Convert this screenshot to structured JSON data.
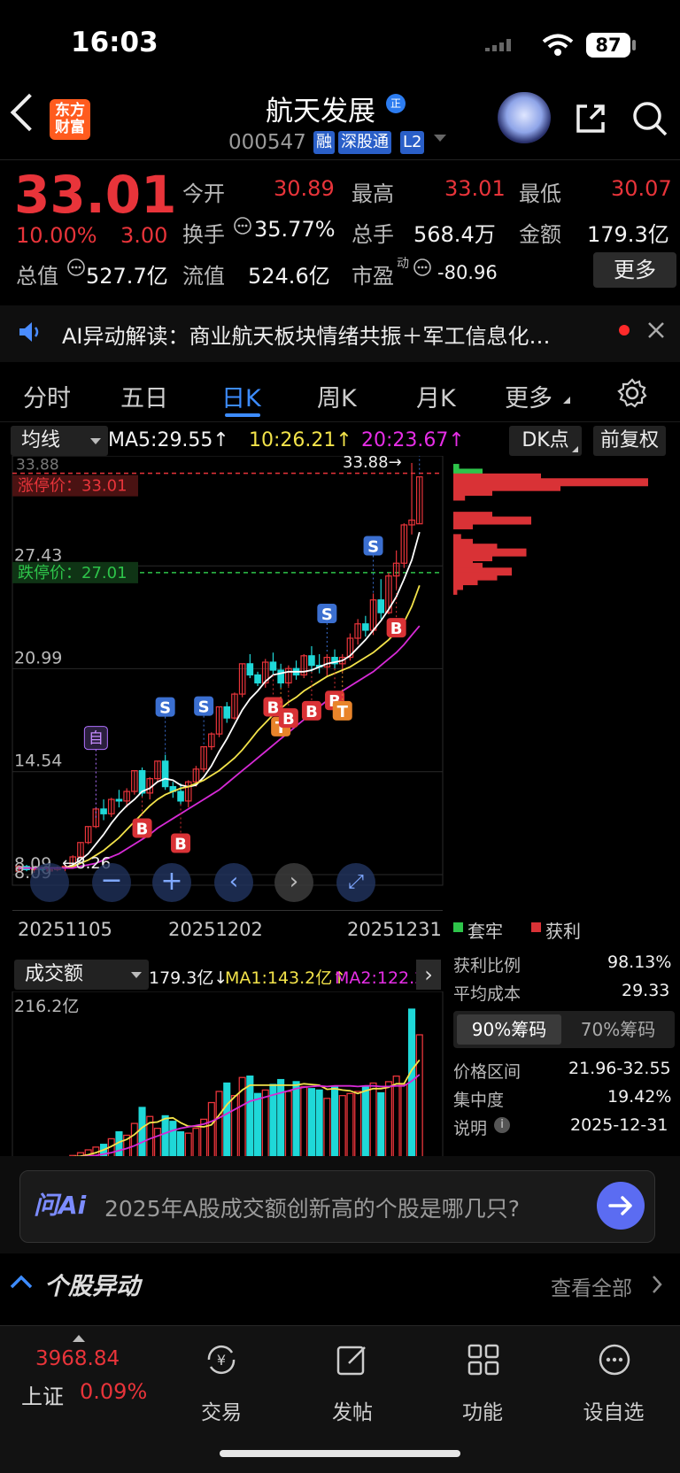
{
  "status_bar": {
    "time": "16:03",
    "battery": "87"
  },
  "header": {
    "logo_line1": "东方",
    "logo_line2": "财富",
    "stock_name": "航天发展",
    "badge": "正",
    "code": "000547",
    "tags": [
      "融",
      "深股通",
      "L2"
    ]
  },
  "quote": {
    "price": "33.01",
    "change_pct": "10.00%",
    "change_amt": "3.00",
    "open_label": "今开",
    "open": "30.89",
    "high_label": "最高",
    "high": "33.01",
    "low_label": "最低",
    "low": "30.07",
    "turnover_label": "换手",
    "turnover": "35.77%",
    "volume_label": "总手",
    "volume": "568.4万",
    "amount_label": "金额",
    "amount": "179.3亿",
    "mcap_label": "总值",
    "mcap": "527.7亿",
    "float_label": "流值",
    "float_cap": "524.6亿",
    "pe_label": "市盈",
    "pe_sup": "动",
    "pe": "-80.96",
    "more": "更多"
  },
  "ai_banner": {
    "text": "AI异动解读：商业航天板块情绪共振＋军工信息化…"
  },
  "tabs": [
    "分时",
    "五日",
    "日K",
    "周K",
    "月K",
    "更多"
  ],
  "active_tab": "日K",
  "chart_toolbar": {
    "indicator": "均线",
    "ma5": "MA5:29.55↑",
    "ma10": "10:26.21↑",
    "ma20": "20:23.67↑",
    "dk": "DK点",
    "adjust": "前复权"
  },
  "price_chart": {
    "limit_up": "涨停价：33.01",
    "limit_down": "跌停价：27.01",
    "top_label": "33.88",
    "high_marker": "33.88",
    "low_marker": "8.26",
    "self_select_marker": "自"
  },
  "chart_data": [
    {
      "type": "candlestick",
      "y_ticks": [
        "27.43",
        "20.99",
        "14.54",
        "8.09"
      ],
      "x_labels": [
        "20251105",
        "20251202",
        "20251231"
      ],
      "ylim": [
        8.09,
        33.88
      ],
      "candles": [
        [
          8.3,
          8.7,
          8.2,
          8.6
        ],
        [
          8.6,
          8.7,
          8.3,
          8.4
        ],
        [
          8.4,
          8.6,
          8.2,
          8.5
        ],
        [
          8.5,
          8.6,
          8.3,
          8.4
        ],
        [
          8.4,
          8.5,
          8.26,
          8.4
        ],
        [
          8.4,
          8.6,
          8.3,
          8.5
        ],
        [
          8.5,
          8.7,
          8.3,
          8.6
        ],
        [
          8.6,
          9.3,
          8.5,
          9.2
        ],
        [
          9.2,
          10.1,
          9.1,
          10.1
        ],
        [
          10.1,
          11.1,
          10.0,
          11.1
        ],
        [
          11.1,
          12.2,
          11.0,
          12.2
        ],
        [
          12.2,
          12.8,
          11.5,
          11.9
        ],
        [
          11.9,
          12.9,
          11.7,
          12.8
        ],
        [
          12.8,
          13.4,
          12.3,
          12.7
        ],
        [
          12.7,
          13.5,
          12.3,
          13.3
        ],
        [
          13.3,
          14.6,
          13.1,
          14.6
        ],
        [
          14.6,
          14.8,
          13.0,
          13.2
        ],
        [
          13.2,
          14.2,
          12.8,
          14.1
        ],
        [
          14.1,
          15.2,
          13.9,
          15.2
        ],
        [
          15.2,
          15.6,
          13.4,
          13.6
        ],
        [
          13.6,
          13.9,
          12.9,
          13.3
        ],
        [
          13.3,
          13.8,
          12.5,
          12.7
        ],
        [
          12.7,
          14.0,
          12.3,
          13.9
        ],
        [
          13.9,
          14.9,
          13.6,
          14.7
        ],
        [
          14.7,
          16.1,
          14.5,
          16.1
        ],
        [
          16.1,
          17.0,
          15.9,
          16.9
        ],
        [
          16.9,
          18.6,
          16.7,
          18.6
        ],
        [
          18.6,
          18.9,
          17.6,
          17.9
        ],
        [
          17.9,
          19.5,
          17.8,
          19.4
        ],
        [
          19.4,
          21.3,
          19.2,
          21.3
        ],
        [
          21.3,
          21.9,
          20.4,
          20.6
        ],
        [
          20.6,
          20.8,
          19.9,
          20.1
        ],
        [
          20.1,
          21.6,
          19.8,
          21.4
        ],
        [
          21.4,
          22.0,
          20.6,
          20.9
        ],
        [
          20.9,
          21.3,
          19.8,
          20.1
        ],
        [
          20.1,
          21.2,
          19.9,
          21.0
        ],
        [
          21.0,
          21.5,
          20.3,
          20.6
        ],
        [
          20.6,
          21.9,
          20.4,
          21.8
        ],
        [
          21.8,
          22.4,
          20.8,
          21.2
        ],
        [
          21.2,
          21.9,
          20.7,
          21.1
        ],
        [
          21.1,
          21.9,
          20.5,
          21.7
        ],
        [
          21.7,
          22.2,
          21.0,
          21.3
        ],
        [
          21.3,
          21.9,
          20.8,
          21.7
        ],
        [
          21.7,
          23.2,
          21.5,
          22.9
        ],
        [
          22.9,
          24.1,
          22.5,
          23.8
        ],
        [
          23.8,
          24.3,
          23.0,
          23.4
        ],
        [
          23.4,
          25.7,
          23.1,
          25.3
        ],
        [
          25.3,
          26.6,
          24.1,
          24.5
        ],
        [
          24.5,
          27.0,
          24.4,
          26.8
        ],
        [
          26.8,
          28.4,
          26.0,
          27.6
        ],
        [
          27.6,
          30.1,
          27.3,
          30.0
        ],
        [
          30.0,
          33.88,
          29.4,
          30.3
        ],
        [
          30.07,
          33.01,
          30.07,
          33.01
        ]
      ],
      "series": [
        {
          "name": "MA5",
          "values": [
            8.5,
            8.5,
            8.5,
            8.5,
            8.5,
            8.5,
            8.5,
            8.7,
            9.0,
            9.4,
            10.0,
            10.6,
            11.3,
            11.9,
            12.4,
            12.8,
            13.3,
            13.5,
            13.9,
            14.1,
            14.0,
            13.7,
            13.6,
            13.7,
            14.2,
            14.9,
            15.8,
            16.6,
            17.5,
            18.4,
            19.1,
            19.6,
            20.2,
            20.6,
            20.7,
            20.8,
            20.8,
            20.8,
            20.9,
            21.1,
            21.3,
            21.4,
            21.5,
            21.8,
            22.3,
            22.8,
            23.4,
            24.0,
            24.7,
            25.5,
            26.6,
            27.8,
            29.55
          ]
        },
        {
          "name": "MA10",
          "values": [
            8.5,
            8.5,
            8.5,
            8.5,
            8.5,
            8.5,
            8.5,
            8.6,
            8.8,
            9.0,
            9.3,
            9.6,
            10.0,
            10.4,
            10.9,
            11.4,
            11.9,
            12.4,
            12.8,
            13.1,
            13.3,
            13.5,
            13.6,
            13.8,
            14.0,
            14.3,
            14.6,
            15.0,
            15.4,
            15.9,
            16.5,
            17.1,
            17.6,
            18.1,
            18.5,
            18.9,
            19.2,
            19.6,
            19.9,
            20.2,
            20.5,
            20.7,
            20.9,
            21.1,
            21.4,
            21.7,
            22.0,
            22.4,
            22.8,
            23.3,
            23.9,
            24.9,
            26.21
          ]
        },
        {
          "name": "MA20",
          "values": [
            8.5,
            8.5,
            8.5,
            8.5,
            8.5,
            8.5,
            8.5,
            8.5,
            8.6,
            8.7,
            8.8,
            9.0,
            9.2,
            9.4,
            9.7,
            10.0,
            10.3,
            10.6,
            11.0,
            11.3,
            11.6,
            11.9,
            12.2,
            12.5,
            12.8,
            13.1,
            13.4,
            13.8,
            14.2,
            14.6,
            15.0,
            15.4,
            15.8,
            16.2,
            16.6,
            17.0,
            17.4,
            17.8,
            18.2,
            18.6,
            19.0,
            19.3,
            19.6,
            19.9,
            20.2,
            20.5,
            20.8,
            21.2,
            21.6,
            22.0,
            22.5,
            23.1,
            23.67
          ]
        }
      ],
      "signals": [
        {
          "label": "B",
          "i": 16
        },
        {
          "label": "S",
          "i": 19
        },
        {
          "label": "S",
          "i": 24
        },
        {
          "label": "B",
          "i": 21
        },
        {
          "label": "B",
          "i": 33
        },
        {
          "label": "T",
          "i": 34
        },
        {
          "label": "B",
          "i": 35
        },
        {
          "label": "B",
          "i": 38
        },
        {
          "label": "B",
          "i": 41
        },
        {
          "label": "T",
          "i": 42
        },
        {
          "label": "S",
          "i": 40
        },
        {
          "label": "S",
          "i": 46
        },
        {
          "label": "S",
          "i": 52
        },
        {
          "label": "B",
          "i": 49
        }
      ]
    },
    {
      "type": "bar",
      "title": "成交额",
      "y_top_label": "216.2亿",
      "ylim": [
        0,
        216.2
      ],
      "values": [
        3,
        4,
        3,
        3,
        2,
        3,
        3,
        6,
        10,
        14,
        18,
        22,
        30,
        40,
        35,
        52,
        75,
        62,
        45,
        63,
        55,
        40,
        38,
        45,
        58,
        82,
        98,
        110,
        92,
        118,
        120,
        95,
        100,
        108,
        115,
        98,
        112,
        105,
        102,
        100,
        88,
        104,
        92,
        95,
        98,
        105,
        110,
        96,
        112,
        120,
        108,
        216.2,
        179.3
      ],
      "up": [
        1,
        0,
        1,
        0,
        0,
        1,
        1,
        1,
        1,
        1,
        1,
        0,
        1,
        0,
        1,
        1,
        0,
        1,
        1,
        0,
        0,
        0,
        1,
        1,
        1,
        1,
        1,
        0,
        1,
        1,
        0,
        0,
        1,
        0,
        0,
        1,
        0,
        1,
        0,
        0,
        1,
        0,
        1,
        1,
        1,
        0,
        1,
        0,
        1,
        1,
        1,
        0,
        1
      ],
      "series": [
        {
          "name": "MA1",
          "values": [
            3,
            3,
            3,
            3,
            3,
            3,
            3,
            4,
            5,
            7,
            10,
            14,
            19,
            25,
            29,
            36,
            46,
            53,
            54,
            59,
            60,
            53,
            48,
            48,
            47,
            50,
            64,
            79,
            90,
            100,
            107,
            107,
            107,
            107,
            107,
            107,
            107,
            109,
            108,
            107,
            101,
            102,
            100,
            99,
            95,
            99,
            102,
            102,
            104,
            109,
            109,
            129,
            143.2
          ]
        },
        {
          "name": "MA2",
          "values": [
            3,
            3,
            3,
            3,
            3,
            3,
            3,
            3,
            4,
            5,
            6,
            8,
            10,
            13,
            16,
            20,
            25,
            30,
            34,
            38,
            42,
            45,
            47,
            49,
            51,
            55,
            60,
            66,
            72,
            78,
            84,
            87,
            90,
            93,
            96,
            99,
            102,
            104,
            105,
            106,
            105,
            106,
            106,
            106,
            105,
            106,
            106,
            105,
            105,
            106,
            106,
            113,
            122.2
          ]
        }
      ]
    }
  ],
  "volume_header": {
    "indicator": "成交额",
    "value": "179.3亿↓",
    "ma1": "MA1:143.2亿↑",
    "ma2": "MA2:122.2亿"
  },
  "chip_panel": {
    "legend_loss": "套牢",
    "legend_profit": "获利",
    "profit_ratio_label": "获利比例",
    "profit_ratio": "98.13%",
    "avg_cost_label": "平均成本",
    "avg_cost": "29.33",
    "seg_on": "90%筹码",
    "seg_off": "70%筹码",
    "range_label": "价格区间",
    "range": "21.96-32.55",
    "concentration_label": "集中度",
    "concentration": "19.42%",
    "note_label": "说明",
    "note_date": "2025-12-31",
    "colors": {
      "profit": "#d93236",
      "loss": "#2ec44a"
    }
  },
  "chat": {
    "logo": "问Ai",
    "placeholder": "2025年A股成交额创新高的个股是哪几只?"
  },
  "section": {
    "title": "个股异动",
    "see_all": "查看全部"
  },
  "bottom_nav": {
    "index_value": "3968.84",
    "index_name": "上证",
    "index_change": "0.09%",
    "items": [
      "交易",
      "发帖",
      "功能",
      "设自选"
    ]
  },
  "colors": {
    "up": "#e8343a",
    "down": "#1fd8d8",
    "ma5": "#ffffff",
    "ma10": "#f3e34a",
    "ma20": "#d62ad6",
    "accent": "#3d8cff"
  }
}
